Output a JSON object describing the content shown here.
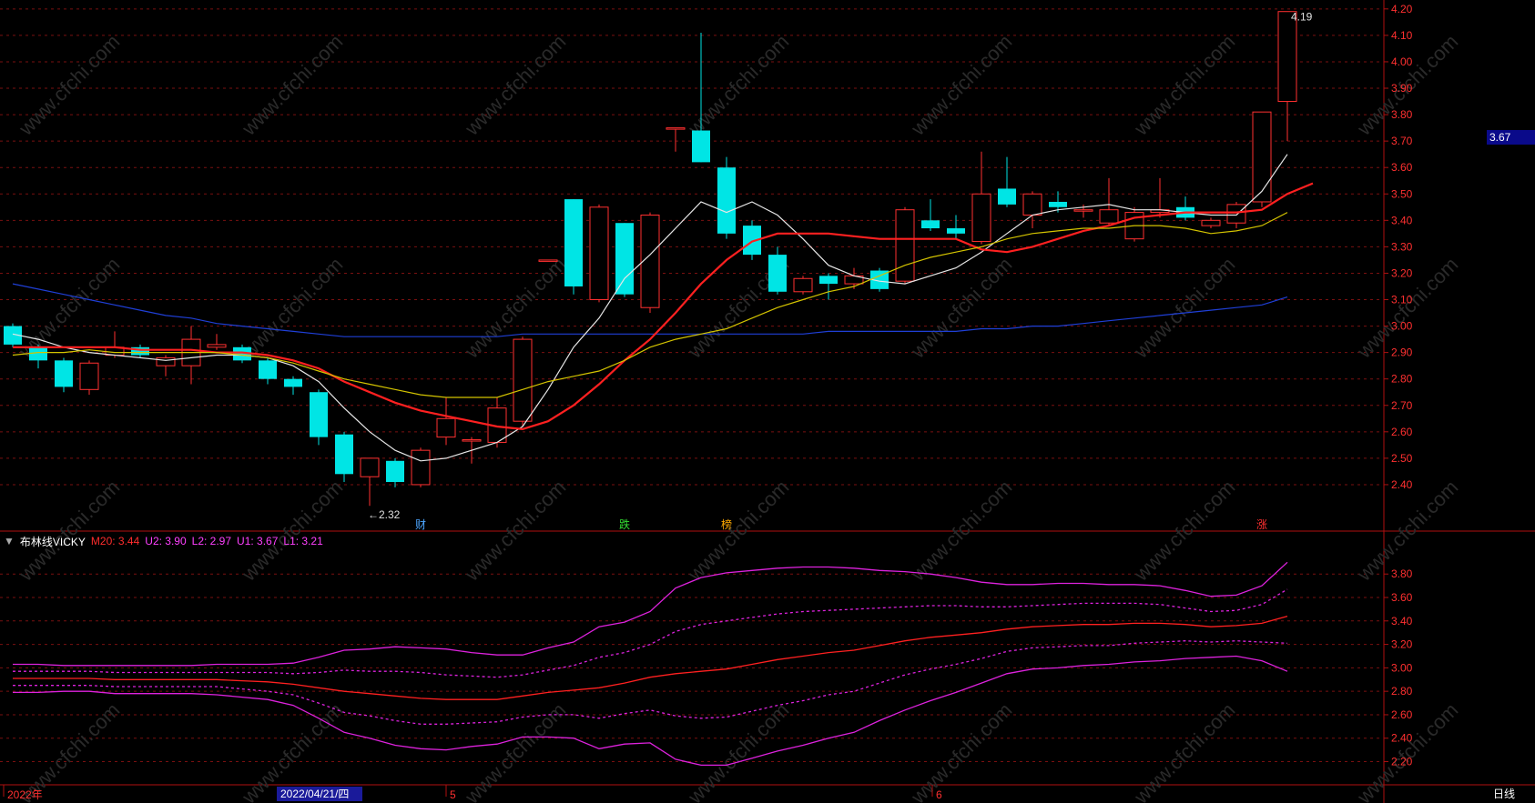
{
  "header": {
    "indicator_name": "布林线VICKY",
    "values": [
      {
        "label": "M20: 3.44",
        "color": "#ff2d2d"
      },
      {
        "label": "U2: 3.90",
        "color": "#ff40ff"
      },
      {
        "label": "L2: 2.97",
        "color": "#ff40ff"
      },
      {
        "label": "U1: 3.67",
        "color": "#ff40ff"
      },
      {
        "label": "L1: 3.21",
        "color": "#ff40ff"
      }
    ]
  },
  "current_price_label": "3.67",
  "period_label": "日线",
  "x_axis": {
    "labels": [
      {
        "text": "2022年",
        "color": "#ff3030"
      },
      {
        "text": "2022/04/21/四",
        "color": "#ffffff",
        "highlight": true
      },
      {
        "text": "5",
        "color": "#ff3030"
      },
      {
        "text": "6",
        "color": "#ff3030"
      }
    ]
  },
  "markers": [
    {
      "text": "财",
      "color": "#4da6ff"
    },
    {
      "text": "跌",
      "color": "#33dd33"
    },
    {
      "text": "榜",
      "color": "#ffaa00"
    },
    {
      "text": "涨",
      "color": "#ff3030"
    }
  ],
  "annotations": [
    {
      "text": "←2.32",
      "color": "#e0e0e0"
    },
    {
      "text": "4.19",
      "color": "#e0e0e0"
    }
  ],
  "watermark": "www.cfchi.com",
  "colors": {
    "up": "#ff3030",
    "down": "#00e5e5",
    "grid": "#7a1010",
    "ma5": "#e6e6e6",
    "ma10": "#ff2020",
    "ma20": "#d4c400",
    "ma60": "#1f3fd6"
  },
  "chart_data": [
    {
      "type": "candlestick",
      "y_ticks": [
        "4.20",
        "4.10",
        "4.00",
        "3.90",
        "3.80",
        "3.70",
        "3.60",
        "3.50",
        "3.40",
        "3.30",
        "3.20",
        "3.10",
        "3.00",
        "2.90",
        "2.80",
        "2.70",
        "2.60",
        "2.50",
        "2.40"
      ],
      "ylim": [
        2.3,
        4.22
      ],
      "candles": [
        {
          "o": 3.0,
          "c": 2.93,
          "h": 3.01,
          "l": 2.92
        },
        {
          "o": 2.92,
          "c": 2.87,
          "h": 2.93,
          "l": 2.84
        },
        {
          "o": 2.87,
          "c": 2.77,
          "h": 2.88,
          "l": 2.75
        },
        {
          "o": 2.76,
          "c": 2.86,
          "h": 2.87,
          "l": 2.74
        },
        {
          "o": 2.89,
          "c": 2.92,
          "h": 2.98,
          "l": 2.88
        },
        {
          "o": 2.92,
          "c": 2.89,
          "h": 2.93,
          "l": 2.88
        },
        {
          "o": 2.85,
          "c": 2.88,
          "h": 2.89,
          "l": 2.81
        },
        {
          "o": 2.85,
          "c": 2.95,
          "h": 3.0,
          "l": 2.78
        },
        {
          "o": 2.92,
          "c": 2.93,
          "h": 2.97,
          "l": 2.91
        },
        {
          "o": 2.92,
          "c": 2.87,
          "h": 2.93,
          "l": 2.86
        },
        {
          "o": 2.87,
          "c": 2.8,
          "h": 2.88,
          "l": 2.78
        },
        {
          "o": 2.8,
          "c": 2.77,
          "h": 2.81,
          "l": 2.74
        },
        {
          "o": 2.75,
          "c": 2.58,
          "h": 2.76,
          "l": 2.55
        },
        {
          "o": 2.59,
          "c": 2.44,
          "h": 2.6,
          "l": 2.41
        },
        {
          "o": 2.43,
          "c": 2.5,
          "h": 2.5,
          "l": 2.32
        },
        {
          "o": 2.49,
          "c": 2.41,
          "h": 2.5,
          "l": 2.39
        },
        {
          "o": 2.4,
          "c": 2.53,
          "h": 2.54,
          "l": 2.39
        },
        {
          "o": 2.58,
          "c": 2.65,
          "h": 2.73,
          "l": 2.55
        },
        {
          "o": 2.57,
          "c": 2.57,
          "h": 2.58,
          "l": 2.48
        },
        {
          "o": 2.56,
          "c": 2.69,
          "h": 2.73,
          "l": 2.54
        },
        {
          "o": 2.64,
          "c": 2.95,
          "h": 2.96,
          "l": 2.62
        },
        {
          "o": 3.25,
          "c": 3.25,
          "h": 3.25,
          "l": 3.25
        },
        {
          "o": 3.48,
          "c": 3.15,
          "h": 3.48,
          "l": 3.12
        },
        {
          "o": 3.1,
          "c": 3.45,
          "h": 3.46,
          "l": 3.09
        },
        {
          "o": 3.39,
          "c": 3.12,
          "h": 3.39,
          "l": 3.11
        },
        {
          "o": 3.07,
          "c": 3.42,
          "h": 3.43,
          "l": 3.05
        },
        {
          "o": 3.75,
          "c": 3.75,
          "h": 3.75,
          "l": 3.66
        },
        {
          "o": 3.74,
          "c": 3.62,
          "h": 4.11,
          "l": 3.62
        },
        {
          "o": 3.6,
          "c": 3.35,
          "h": 3.64,
          "l": 3.33
        },
        {
          "o": 3.38,
          "c": 3.27,
          "h": 3.4,
          "l": 3.25
        },
        {
          "o": 3.27,
          "c": 3.13,
          "h": 3.3,
          "l": 3.12
        },
        {
          "o": 3.13,
          "c": 3.18,
          "h": 3.19,
          "l": 3.12
        },
        {
          "o": 3.19,
          "c": 3.16,
          "h": 3.2,
          "l": 3.1
        },
        {
          "o": 3.16,
          "c": 3.19,
          "h": 3.22,
          "l": 3.14
        },
        {
          "o": 3.21,
          "c": 3.14,
          "h": 3.22,
          "l": 3.13
        },
        {
          "o": 3.17,
          "c": 3.44,
          "h": 3.45,
          "l": 3.16
        },
        {
          "o": 3.4,
          "c": 3.37,
          "h": 3.48,
          "l": 3.36
        },
        {
          "o": 3.37,
          "c": 3.35,
          "h": 3.42,
          "l": 3.33
        },
        {
          "o": 3.32,
          "c": 3.5,
          "h": 3.66,
          "l": 3.31
        },
        {
          "o": 3.52,
          "c": 3.46,
          "h": 3.64,
          "l": 3.45
        },
        {
          "o": 3.42,
          "c": 3.5,
          "h": 3.51,
          "l": 3.37
        },
        {
          "o": 3.47,
          "c": 3.45,
          "h": 3.51,
          "l": 3.43
        },
        {
          "o": 3.44,
          "c": 3.44,
          "h": 3.46,
          "l": 3.41
        },
        {
          "o": 3.39,
          "c": 3.44,
          "h": 3.56,
          "l": 3.38
        },
        {
          "o": 3.33,
          "c": 3.43,
          "h": 3.45,
          "l": 3.32
        },
        {
          "o": 3.43,
          "c": 3.44,
          "h": 3.56,
          "l": 3.41
        },
        {
          "o": 3.45,
          "c": 3.41,
          "h": 3.49,
          "l": 3.4
        },
        {
          "o": 3.38,
          "c": 3.4,
          "h": 3.41,
          "l": 3.37
        },
        {
          "o": 3.39,
          "c": 3.46,
          "h": 3.47,
          "l": 3.37
        },
        {
          "o": 3.47,
          "c": 3.81,
          "h": 3.81,
          "l": 3.45
        },
        {
          "o": 3.85,
          "c": 4.19,
          "h": 4.19,
          "l": 3.7
        }
      ],
      "series": [
        {
          "key": "ma5",
          "values": [
            2.97,
            2.95,
            2.92,
            2.9,
            2.89,
            2.88,
            2.87,
            2.88,
            2.89,
            2.89,
            2.88,
            2.85,
            2.79,
            2.69,
            2.6,
            2.53,
            2.49,
            2.5,
            2.53,
            2.56,
            2.62,
            2.76,
            2.92,
            3.03,
            3.18,
            3.27,
            3.37,
            3.47,
            3.43,
            3.47,
            3.42,
            3.33,
            3.23,
            3.19,
            3.17,
            3.16,
            3.19,
            3.22,
            3.28,
            3.35,
            3.42,
            3.44,
            3.45,
            3.46,
            3.44,
            3.44,
            3.43,
            3.42,
            3.42,
            3.51,
            3.65
          ]
        },
        {
          "key": "ma10",
          "values": [
            2.92,
            2.92,
            2.92,
            2.92,
            2.92,
            2.91,
            2.91,
            2.91,
            2.9,
            2.9,
            2.89,
            2.87,
            2.84,
            2.79,
            2.75,
            2.71,
            2.68,
            2.66,
            2.64,
            2.62,
            2.61,
            2.64,
            2.7,
            2.78,
            2.87,
            2.95,
            3.05,
            3.16,
            3.25,
            3.32,
            3.35,
            3.35,
            3.35,
            3.34,
            3.33,
            3.33,
            3.33,
            3.33,
            3.29,
            3.28,
            3.3,
            3.33,
            3.36,
            3.38,
            3.41,
            3.42,
            3.43,
            3.43,
            3.43,
            3.44,
            3.5,
            3.54
          ]
        },
        {
          "key": "ma20",
          "values": [
            2.89,
            2.9,
            2.9,
            2.91,
            2.9,
            2.9,
            2.9,
            2.9,
            2.9,
            2.89,
            2.88,
            2.86,
            2.83,
            2.8,
            2.78,
            2.76,
            2.74,
            2.73,
            2.73,
            2.73,
            2.76,
            2.79,
            2.81,
            2.83,
            2.87,
            2.92,
            2.95,
            2.97,
            2.99,
            3.03,
            3.07,
            3.1,
            3.13,
            3.15,
            3.19,
            3.23,
            3.26,
            3.28,
            3.3,
            3.33,
            3.35,
            3.36,
            3.37,
            3.37,
            3.38,
            3.38,
            3.37,
            3.35,
            3.36,
            3.38,
            3.43
          ]
        },
        {
          "key": "ma60",
          "values": [
            3.16,
            3.14,
            3.12,
            3.1,
            3.08,
            3.06,
            3.04,
            3.03,
            3.01,
            3.0,
            2.99,
            2.98,
            2.97,
            2.96,
            2.96,
            2.96,
            2.96,
            2.96,
            2.96,
            2.96,
            2.97,
            2.97,
            2.97,
            2.97,
            2.97,
            2.97,
            2.97,
            2.97,
            2.97,
            2.97,
            2.97,
            2.97,
            2.98,
            2.98,
            2.98,
            2.98,
            2.98,
            2.98,
            2.99,
            2.99,
            3.0,
            3.0,
            3.01,
            3.02,
            3.03,
            3.04,
            3.05,
            3.06,
            3.07,
            3.08,
            3.11
          ]
        }
      ]
    },
    {
      "type": "line",
      "title": "布林线VICKY",
      "y_ticks": [
        "3.80",
        "3.60",
        "3.40",
        "3.20",
        "3.00",
        "2.80",
        "2.60",
        "2.40",
        "2.20"
      ],
      "ylim": [
        2.08,
        3.98
      ],
      "series": [
        {
          "name": "M20",
          "style": "solid",
          "color": "#ff2020",
          "values": [
            2.91,
            2.91,
            2.91,
            2.91,
            2.9,
            2.9,
            2.9,
            2.9,
            2.9,
            2.89,
            2.88,
            2.86,
            2.83,
            2.8,
            2.78,
            2.76,
            2.74,
            2.73,
            2.73,
            2.73,
            2.76,
            2.79,
            2.81,
            2.83,
            2.87,
            2.92,
            2.95,
            2.97,
            2.99,
            3.03,
            3.07,
            3.1,
            3.13,
            3.15,
            3.19,
            3.23,
            3.26,
            3.28,
            3.3,
            3.33,
            3.35,
            3.36,
            3.37,
            3.37,
            3.38,
            3.38,
            3.37,
            3.35,
            3.36,
            3.38,
            3.44
          ]
        },
        {
          "name": "U2",
          "style": "solid",
          "color": "#dd22dd",
          "values": [
            3.03,
            3.03,
            3.02,
            3.02,
            3.02,
            3.02,
            3.02,
            3.02,
            3.03,
            3.03,
            3.03,
            3.04,
            3.09,
            3.15,
            3.16,
            3.18,
            3.17,
            3.16,
            3.13,
            3.11,
            3.11,
            3.17,
            3.22,
            3.35,
            3.39,
            3.48,
            3.68,
            3.77,
            3.81,
            3.83,
            3.85,
            3.86,
            3.86,
            3.85,
            3.83,
            3.82,
            3.8,
            3.77,
            3.73,
            3.71,
            3.71,
            3.72,
            3.72,
            3.71,
            3.71,
            3.7,
            3.66,
            3.61,
            3.62,
            3.7,
            3.9
          ]
        },
        {
          "name": "U1",
          "style": "dashed",
          "color": "#dd22dd",
          "values": [
            2.97,
            2.97,
            2.97,
            2.97,
            2.96,
            2.96,
            2.96,
            2.96,
            2.96,
            2.96,
            2.96,
            2.95,
            2.96,
            2.98,
            2.97,
            2.97,
            2.96,
            2.94,
            2.93,
            2.92,
            2.94,
            2.98,
            3.02,
            3.09,
            3.13,
            3.2,
            3.31,
            3.37,
            3.4,
            3.43,
            3.46,
            3.48,
            3.49,
            3.5,
            3.51,
            3.52,
            3.53,
            3.53,
            3.52,
            3.52,
            3.53,
            3.54,
            3.55,
            3.55,
            3.55,
            3.54,
            3.51,
            3.48,
            3.49,
            3.54,
            3.67
          ]
        },
        {
          "name": "L1",
          "style": "dashed",
          "color": "#dd22dd",
          "values": [
            2.85,
            2.85,
            2.85,
            2.85,
            2.84,
            2.84,
            2.84,
            2.84,
            2.84,
            2.82,
            2.8,
            2.77,
            2.7,
            2.62,
            2.59,
            2.55,
            2.52,
            2.52,
            2.53,
            2.54,
            2.58,
            2.6,
            2.6,
            2.57,
            2.61,
            2.64,
            2.59,
            2.57,
            2.58,
            2.63,
            2.68,
            2.72,
            2.77,
            2.8,
            2.87,
            2.94,
            2.99,
            3.03,
            3.08,
            3.14,
            3.17,
            3.18,
            3.19,
            3.19,
            3.21,
            3.22,
            3.23,
            3.22,
            3.23,
            3.22,
            3.21
          ]
        },
        {
          "name": "L2",
          "style": "solid",
          "color": "#dd22dd",
          "values": [
            2.79,
            2.79,
            2.8,
            2.8,
            2.78,
            2.78,
            2.78,
            2.78,
            2.77,
            2.75,
            2.73,
            2.68,
            2.57,
            2.45,
            2.4,
            2.34,
            2.31,
            2.3,
            2.33,
            2.35,
            2.41,
            2.41,
            2.4,
            2.31,
            2.35,
            2.36,
            2.22,
            2.17,
            2.17,
            2.23,
            2.29,
            2.34,
            2.4,
            2.45,
            2.55,
            2.64,
            2.72,
            2.79,
            2.87,
            2.95,
            2.99,
            3.0,
            3.02,
            3.03,
            3.05,
            3.06,
            3.08,
            3.09,
            3.1,
            3.06,
            2.97
          ]
        }
      ]
    }
  ]
}
